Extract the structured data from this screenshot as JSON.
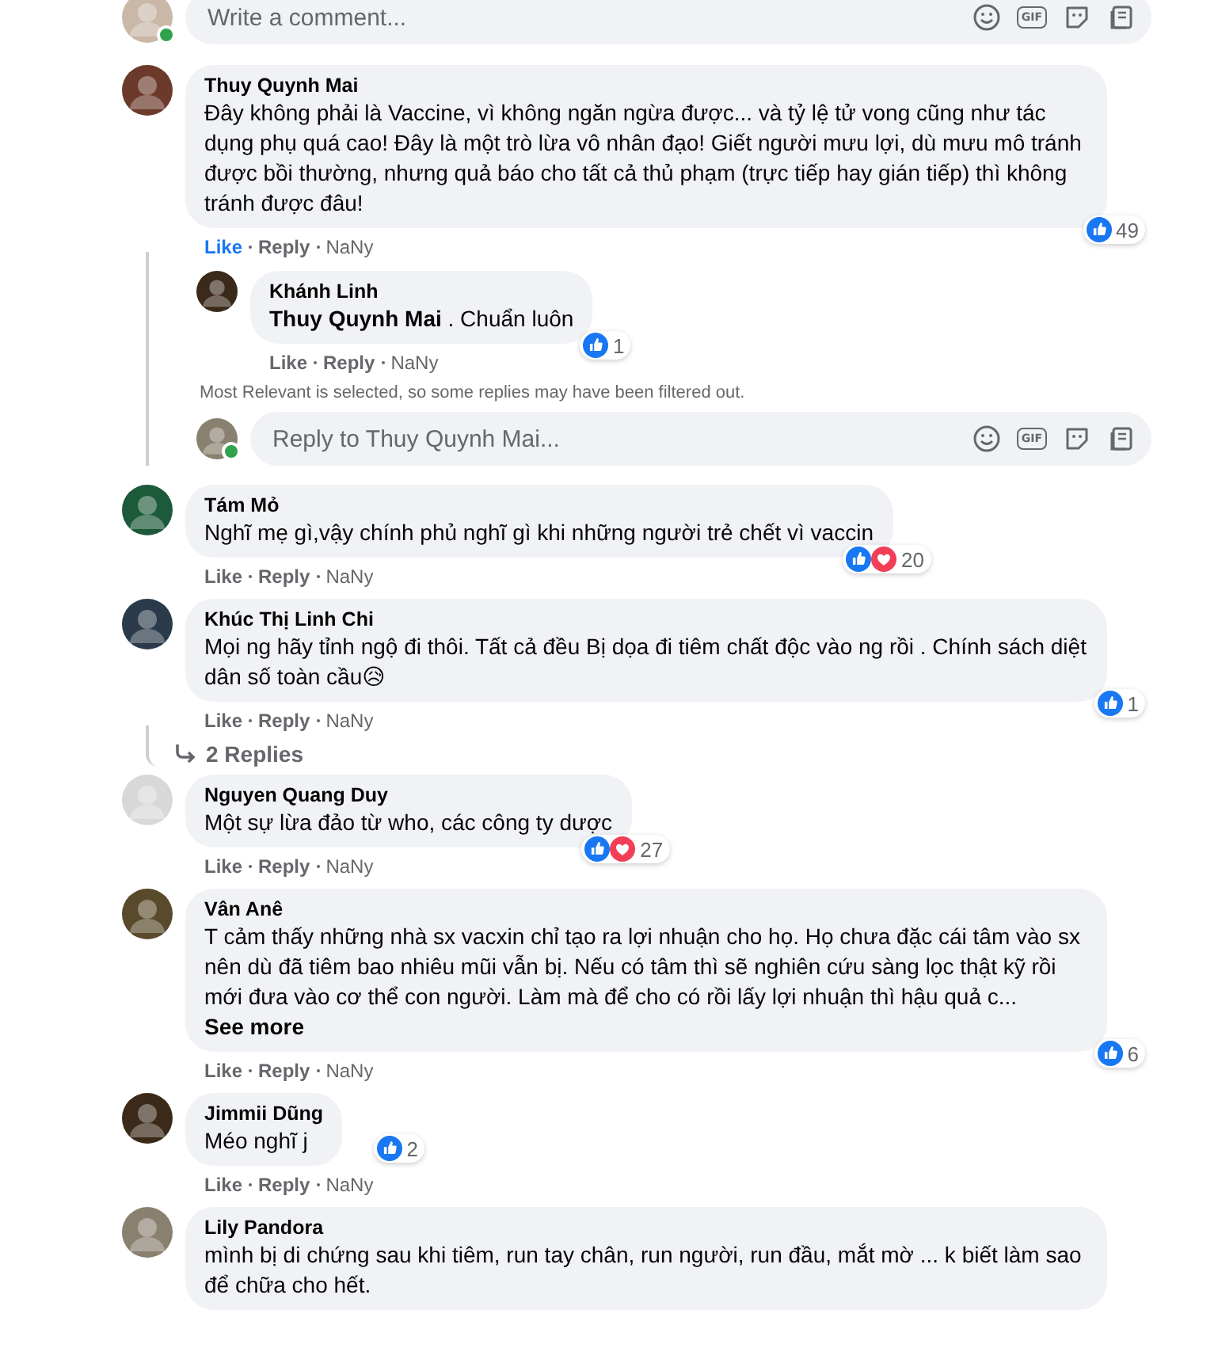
{
  "top_composer": {
    "placeholder": "Write a comment...",
    "online": true,
    "tools": [
      {
        "kind": "emoji"
      },
      {
        "kind": "gif",
        "label": "GIF"
      },
      {
        "kind": "sticker"
      },
      {
        "kind": "note"
      }
    ]
  },
  "comments": [
    {
      "author": "Thuy Quynh Mai",
      "text": "Đây không phải là Vaccine, vì không ngăn ngừa được... và tỷ lệ tử vong cũng như tác dụng phụ quá cao! Đây là một trò lừa vô nhân đạo! Giết người mưu lợi, dù mưu mô tránh được bồi thường, nhưng quả báo cho tất cả thủ phạm (trực tiếp hay gián tiếp) thì không tránh được đâu!",
      "like": "Like",
      "liked": true,
      "reply": "Reply",
      "time": "NaNy",
      "reactions": {
        "like": true,
        "love": false,
        "count": "49"
      },
      "replies": [
        {
          "author": "Khánh Linh",
          "text": "**Thuy Quynh Mai** . Chuẩn luôn",
          "like": "Like",
          "liked": false,
          "reply": "Reply",
          "time": "NaNy",
          "reactions": {
            "like": true,
            "love": false,
            "count": "1"
          }
        }
      ],
      "filter_note": "Most Relevant is selected, so some replies may have been filtered out.",
      "reply_composer": {
        "placeholder": "Reply to Thuy Quynh Mai...",
        "online": true,
        "tools": [
          {
            "kind": "emoji"
          },
          {
            "kind": "gif",
            "label": "GIF"
          },
          {
            "kind": "sticker"
          },
          {
            "kind": "note"
          }
        ]
      }
    },
    {
      "author": "Tám Mỏ",
      "text": "Nghĩ mẹ gì,vậy chính phủ nghĩ gì khi những người trẻ chết vì vaccin",
      "like": "Like",
      "liked": false,
      "reply": "Reply",
      "time": "NaNy",
      "reactions": {
        "like": true,
        "love": true,
        "count": "20"
      }
    },
    {
      "author": "Khúc Thị Linh Chi",
      "text": "Mọi ng hãy tỉnh ngộ đi thôi. Tất cả đều Bị dọa đi tiêm chất độc vào ng rồi . Chính sách diệt dân số toàn cầu😥",
      "like": "Like",
      "liked": false,
      "reply": "Reply",
      "time": "NaNy",
      "reactions": {
        "like": true,
        "love": false,
        "count": "1"
      },
      "replies_link": "2 Replies"
    },
    {
      "author": "Nguyen Quang Duy",
      "text": "Một sự lừa đảo từ who, các công ty dược",
      "like": "Like",
      "liked": false,
      "reply": "Reply",
      "time": "NaNy",
      "reactions": {
        "like": true,
        "love": true,
        "count": "27"
      }
    },
    {
      "author": "Vân Anê",
      "text": "T cảm thấy những nhà sx vacxin chỉ tạo ra lợi nhuận cho họ. Họ chưa đặc cái tâm vào sx nên dù đã tiêm bao nhiêu mũi vẫn bị. Nếu có tâm thì sẽ nghiên cứu sàng lọc thật kỹ rồi mới đưa vào cơ thể con người. Làm mà để cho có rồi lấy lợi nhuận thì hậu quả c...",
      "see_more": "See more",
      "like": "Like",
      "liked": false,
      "reply": "Reply",
      "time": "NaNy",
      "reactions": {
        "like": true,
        "love": false,
        "count": "6"
      }
    },
    {
      "author": "Jimmii Dũng",
      "text": "Méo nghĩ j",
      "like": "Like",
      "liked": false,
      "reply": "Reply",
      "time": "NaNy",
      "reactions": {
        "like": true,
        "love": false,
        "count": "2"
      }
    },
    {
      "author": "Lily Pandora",
      "text": "mình bị di chứng sau khi tiêm, run tay chân, run người, run đầu, mắt mờ ... k biết làm sao để chữa cho hết."
    }
  ]
}
